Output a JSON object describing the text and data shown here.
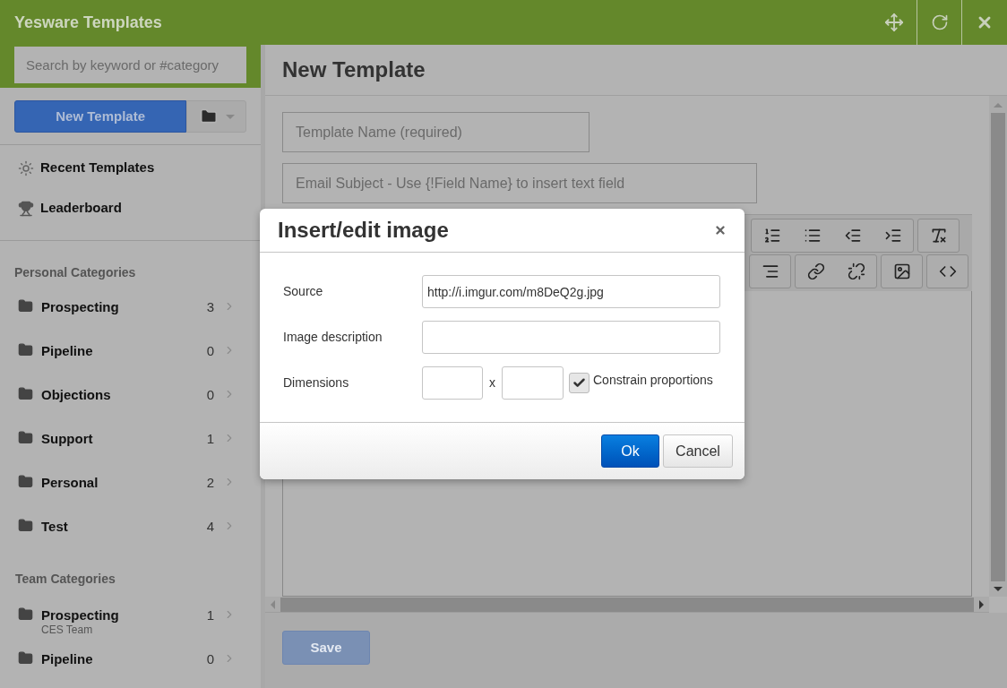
{
  "app": {
    "title": "Yesware Templates"
  },
  "search": {
    "placeholder": "Search by keyword or #category"
  },
  "new_template_button": "New Template",
  "nav": [
    {
      "label": "Recent Templates",
      "kind": "recent"
    },
    {
      "label": "Leaderboard",
      "kind": "leaderboard"
    }
  ],
  "personal_categories": {
    "heading": "Personal Categories",
    "items": [
      {
        "name": "Prospecting",
        "count": "3"
      },
      {
        "name": "Pipeline",
        "count": "0"
      },
      {
        "name": "Objections",
        "count": "0"
      },
      {
        "name": "Support",
        "count": "1"
      },
      {
        "name": "Personal",
        "count": "2"
      },
      {
        "name": "Test",
        "count": "4"
      }
    ]
  },
  "team_categories": {
    "heading": "Team Categories",
    "items": [
      {
        "name": "Prospecting",
        "team": "CES Team",
        "count": "1"
      },
      {
        "name": "Pipeline",
        "count": "0"
      }
    ]
  },
  "editor": {
    "title": "New Template",
    "name_placeholder": "Template Name (required)",
    "subject_placeholder": "Email Subject - Use {!Field Name} to insert text field",
    "save_button": "Save"
  },
  "dialog": {
    "title": "Insert/edit image",
    "source": {
      "label": "Source",
      "value": "http://i.imgur.com/m8DeQ2g.jpg"
    },
    "description": {
      "label": "Image description"
    },
    "dimensions": {
      "label": "Dimensions",
      "separator": "x",
      "constrain_label": "Constrain proportions",
      "constrain_checked": true
    },
    "ok_button": "Ok",
    "cancel_button": "Cancel"
  }
}
